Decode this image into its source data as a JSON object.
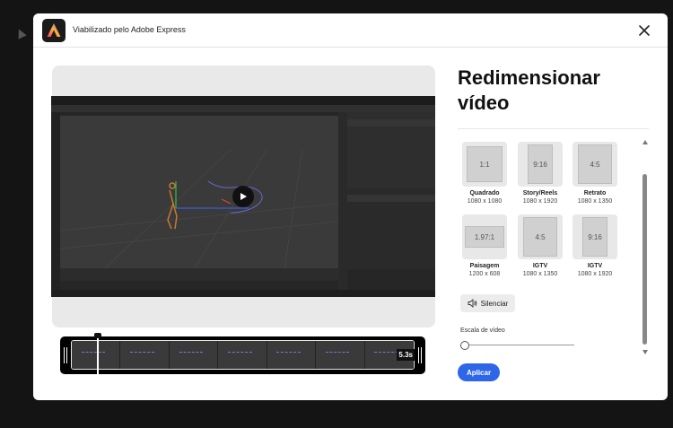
{
  "header": {
    "title": "Viabilizado pelo Adobe Express"
  },
  "panel": {
    "title": "Redimensionar vídeo"
  },
  "presets": [
    {
      "ratio": "1:1",
      "name": "Quadrado",
      "dims": "1080 x 1080"
    },
    {
      "ratio": "9:16",
      "name": "Story/Reels",
      "dims": "1080 x 1920"
    },
    {
      "ratio": "4:5",
      "name": "Retrato",
      "dims": "1080 x 1350"
    },
    {
      "ratio": "1.97:1",
      "name": "Paisagem",
      "dims": "1200 x 608"
    },
    {
      "ratio": "4:5",
      "name": "IGTV",
      "dims": "1080 x 1350"
    },
    {
      "ratio": "9:16",
      "name": "IGTV",
      "dims": "1080 x 1920"
    }
  ],
  "mute": {
    "label": "Silenciar"
  },
  "scale": {
    "label": "Escala de vídeo",
    "value": 0
  },
  "apply": {
    "label": "Aplicar"
  },
  "timeline": {
    "duration": "5.3s"
  },
  "colors": {
    "accent": "#2d66e8",
    "overlay": "#141414"
  }
}
